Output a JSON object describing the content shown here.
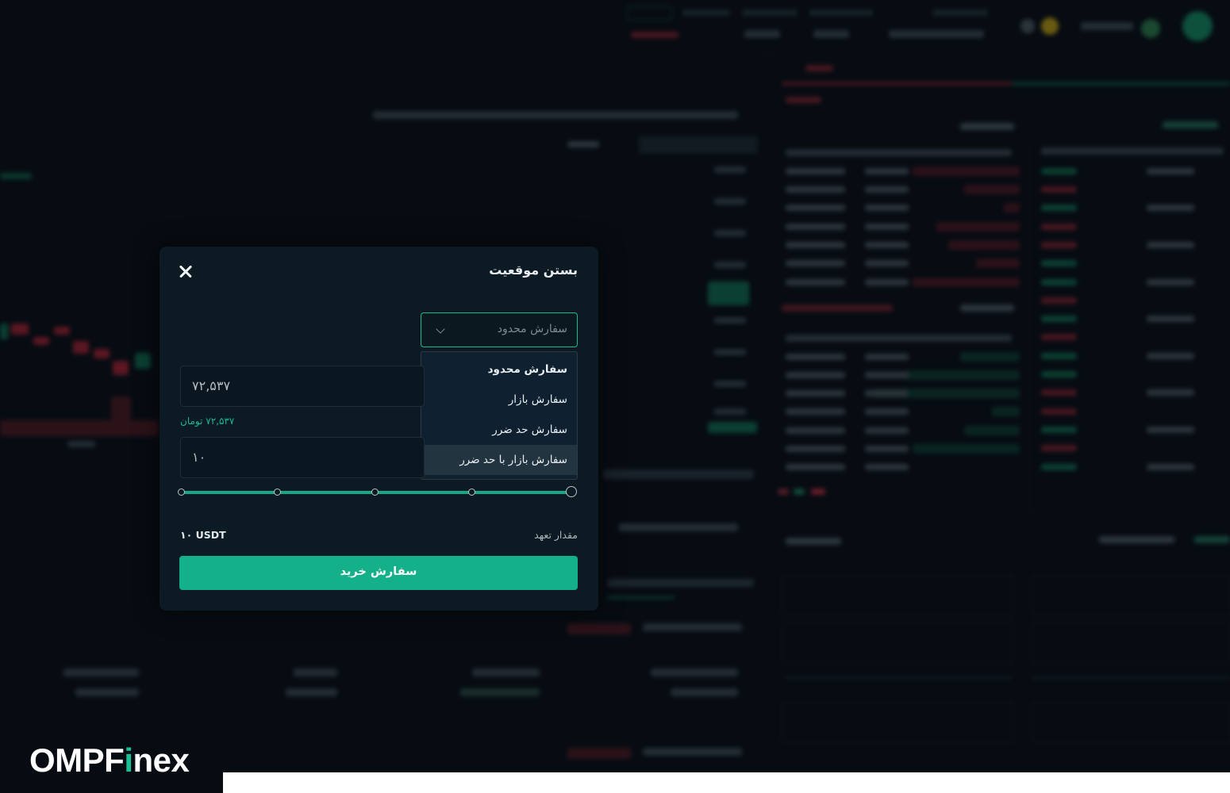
{
  "modal": {
    "title": "بستن موقعیت",
    "order_type_selected": "سفارش محدود",
    "order_type_options": [
      "سفارش محدود",
      "سفارش بازار",
      "سفارش حد ضرر",
      "سفارش بازار با حد ضرر"
    ],
    "price_value": "۷۲,۵۳۷",
    "price_toman_note": "۷۲,۵۳۷ تومان",
    "amount_value": "۱۰",
    "commitment_label": "مقدار تعهد",
    "commitment_value": "۱۰ USDT",
    "buy_button": "سفارش خرید",
    "slider_percent": 100
  },
  "brand": {
    "logo_text_a": "OMPF",
    "logo_text_b": "nex",
    "accent_color": "#13b08a"
  }
}
